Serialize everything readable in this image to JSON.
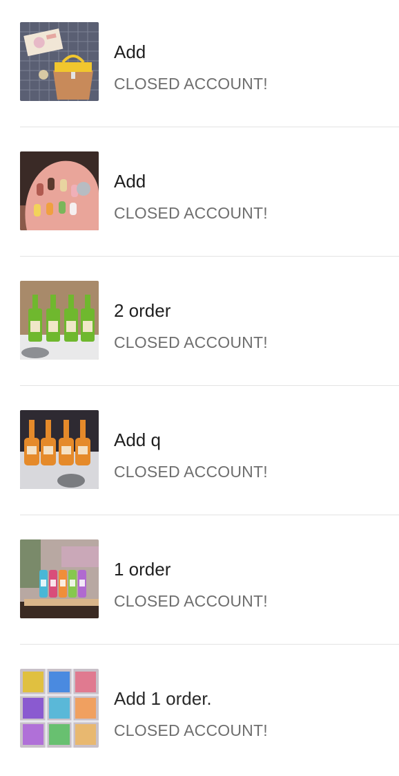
{
  "items": [
    {
      "title": "Add",
      "status": "CLOSED ACCOUNT!",
      "image": "miniature-handbag-photo"
    },
    {
      "title": "Add",
      "status": "CLOSED ACCOUNT!",
      "image": "miniature-popsicles-photo"
    },
    {
      "title": "2 order",
      "status": "CLOSED ACCOUNT!",
      "image": "miniature-green-bottles-photo"
    },
    {
      "title": "Add q",
      "status": "CLOSED ACCOUNT!",
      "image": "miniature-orange-bottles-photo"
    },
    {
      "title": "1 order",
      "status": "CLOSED ACCOUNT!",
      "image": "miniature-drink-bottles-photo"
    },
    {
      "title": "Add 1 order.",
      "status": "CLOSED ACCOUNT!",
      "image": "miniature-candy-boxes-photo"
    }
  ]
}
